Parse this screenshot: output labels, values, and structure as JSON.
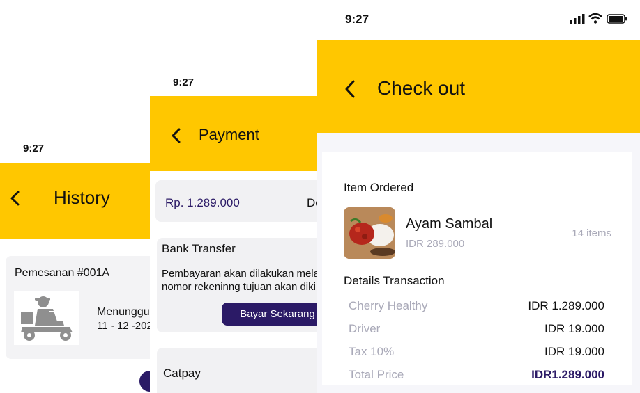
{
  "history": {
    "time": "9:27",
    "title": "History",
    "order_id": "Pemesanan #001A",
    "status": "Menunggu",
    "date": "11 - 12 -202"
  },
  "payment": {
    "time": "9:27",
    "title": "Payment",
    "amount": "Rp. 1.289.000",
    "amount_side": "De",
    "bank_title": "Bank Transfer",
    "bank_desc_1": "Pembayaran akan dilakukan mela",
    "bank_desc_2": "nomor rekeninng tujuan akan diki",
    "pay_button": "Bayar Sekarang",
    "catpay": "Catpay"
  },
  "checkout": {
    "time": "9:27",
    "title": "Check out",
    "section_items": "Item Ordered",
    "item_name": "Ayam Sambal",
    "item_price": "IDR 289.000",
    "item_count": "14 items",
    "section_details": "Details Transaction",
    "rows": [
      {
        "label": "Cherry Healthy",
        "value": "IDR 1.289.000"
      },
      {
        "label": "Driver",
        "value": "IDR 19.000"
      },
      {
        "label": "Tax 10%",
        "value": "IDR 19.000"
      },
      {
        "label": "Total Price",
        "value": "IDR1.289.000"
      }
    ]
  },
  "colors": {
    "accent": "#FFC700",
    "primary": "#2b1a66"
  },
  "icons": [
    "back-arrow-icon",
    "scooter-delivery-icon",
    "signal-icon",
    "wifi-icon",
    "battery-icon"
  ]
}
